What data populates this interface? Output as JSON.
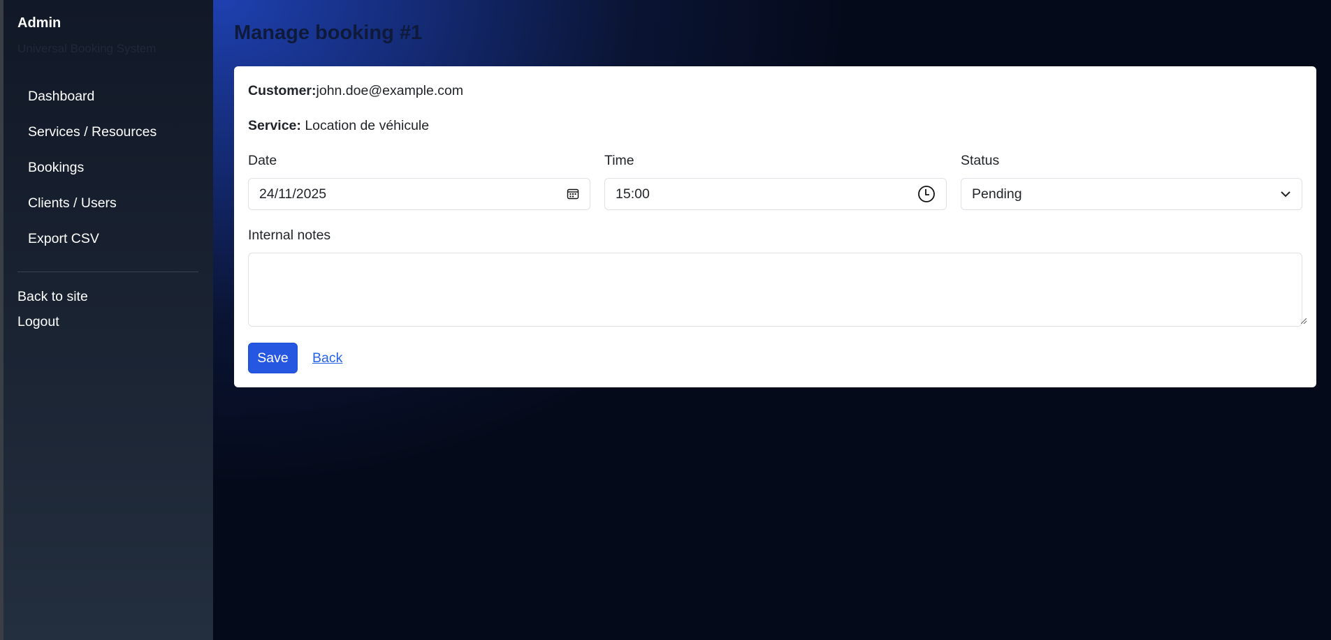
{
  "sidebar": {
    "brand": "Admin",
    "subtitle": "Universal Booking System",
    "nav": [
      {
        "label": "Dashboard"
      },
      {
        "label": "Services / Resources"
      },
      {
        "label": "Bookings"
      },
      {
        "label": "Clients / Users"
      },
      {
        "label": "Export CSV"
      }
    ],
    "links": [
      {
        "label": "Back to site"
      },
      {
        "label": "Logout"
      }
    ]
  },
  "page": {
    "title": "Manage booking #1"
  },
  "form": {
    "customer_label": "Customer:",
    "customer": "john.doe@example.com",
    "service_label": "Service:",
    "service": "Location de véhicule",
    "date_label": "Date",
    "date": "24/11/2025",
    "time_label": "Time",
    "time": "15:00",
    "status_label": "Status",
    "status": "Pending",
    "notes_label": "Internal notes",
    "notes": "",
    "save": "Save",
    "back": "Back"
  }
}
